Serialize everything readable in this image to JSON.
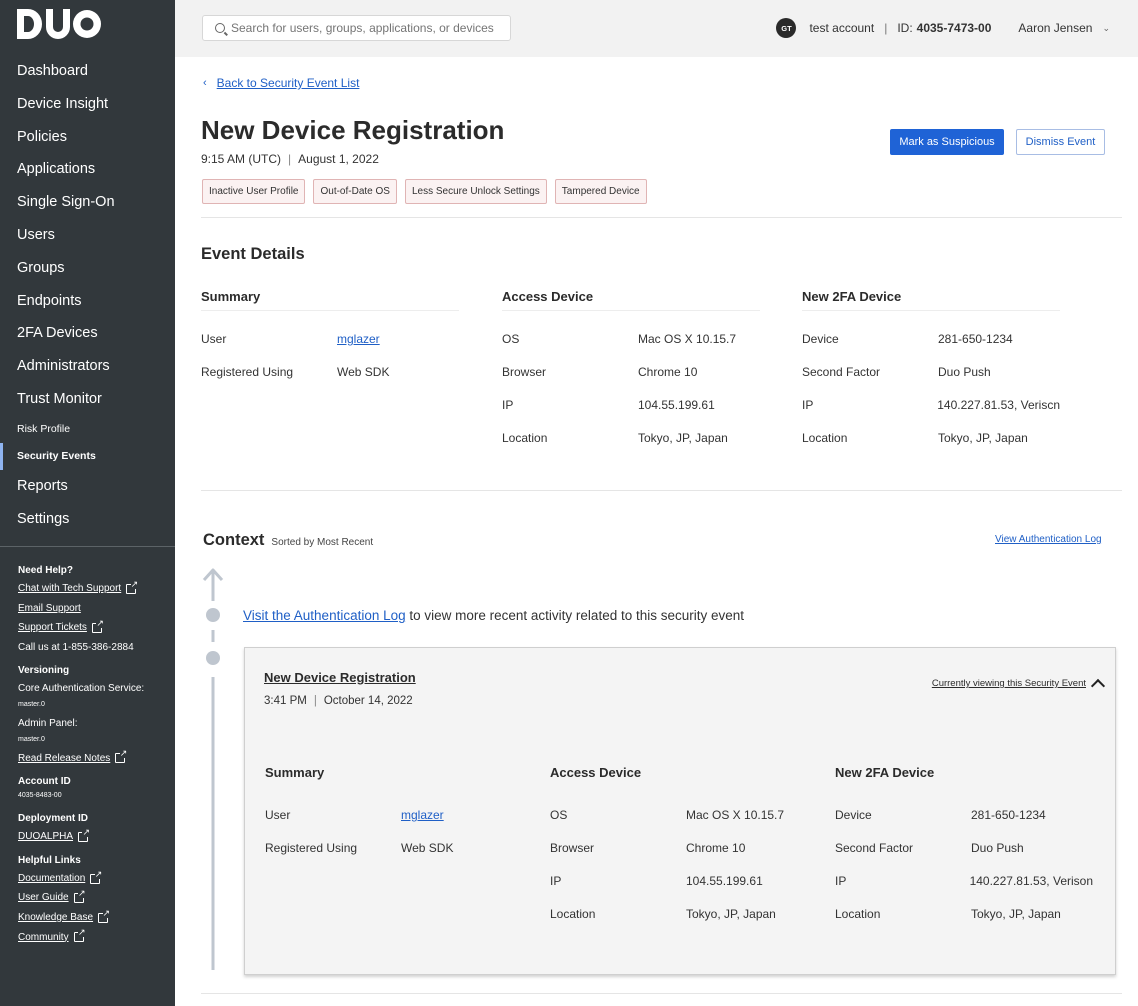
{
  "logo_text": "DUO",
  "nav": {
    "items": [
      {
        "label": "Dashboard"
      },
      {
        "label": "Device Insight"
      },
      {
        "label": "Policies"
      },
      {
        "label": "Applications"
      },
      {
        "label": "Single Sign-On"
      },
      {
        "label": "Users"
      },
      {
        "label": "Groups"
      },
      {
        "label": "Endpoints"
      },
      {
        "label": "2FA Devices"
      },
      {
        "label": "Administrators"
      },
      {
        "label": "Trust Monitor"
      }
    ],
    "sub_items": [
      {
        "label": "Risk Profile"
      },
      {
        "label": "Security Events"
      }
    ],
    "bottom_items": [
      {
        "label": "Reports"
      },
      {
        "label": "Settings"
      }
    ]
  },
  "help": {
    "need_help": "Need Help?",
    "chat": "Chat with Tech Support",
    "email": "Email Support",
    "tickets": "Support Tickets",
    "call": "Call us at 1-855-386-2884",
    "versioning": "Versioning",
    "core_label": "Core Authentication Service:",
    "core_value": "master.0",
    "admin_label": "Admin Panel:",
    "admin_value": "master.0",
    "release_notes": "Read Release Notes",
    "account_id_label": "Account ID",
    "account_id_value": "4035-8483-00",
    "deployment_label": "Deployment ID",
    "deployment_value": "DUOALPHA",
    "helpful_links": "Helpful Links",
    "documentation": "Documentation",
    "user_guide": "User Guide",
    "knowledge_base": "Knowledge Base",
    "community": "Community"
  },
  "header": {
    "search_placeholder": "Search for users, groups, applications, or devices",
    "avatar_initials": "GT",
    "account_name": "test account",
    "id_label": "ID:",
    "id_value": "4035-7473-00",
    "user_name": "Aaron Jensen"
  },
  "page": {
    "back_link": "Back to Security Event List",
    "title": "New Device Registration",
    "time": "9:15 AM (UTC)",
    "date": "August 1, 2022",
    "mark_suspicious": "Mark as Suspicious",
    "dismiss": "Dismiss Event",
    "tags": [
      "Inactive User Profile",
      "Out-of-Date OS",
      "Less Secure Unlock Settings",
      "Tampered Device"
    ]
  },
  "event_details": {
    "title": "Event Details",
    "summary": {
      "heading": "Summary",
      "user_label": "User",
      "user_value": "mglazer",
      "registered_label": "Registered Using",
      "registered_value": "Web SDK"
    },
    "access_device": {
      "heading": "Access Device",
      "os_label": "OS",
      "os_value": "Mac OS X 10.15.7",
      "browser_label": "Browser",
      "browser_value": "Chrome 10",
      "ip_label": "IP",
      "ip_value": "104.55.199.61",
      "location_label": "Location",
      "location_value": "Tokyo, JP, Japan"
    },
    "new_2fa": {
      "heading": "New 2FA Device",
      "device_label": "Device",
      "device_value": "281-650-1234",
      "factor_label": "Second Factor",
      "factor_value": "Duo Push",
      "ip_label": "IP",
      "ip_value": "140.227.81.53, Veriscn",
      "location_label": "Location",
      "location_value": "Tokyo, JP, Japan"
    }
  },
  "context": {
    "title": "Context",
    "sorted": "Sorted by Most Recent",
    "view_auth_log": "View Authentication Log",
    "visit_link": "Visit the Authentication Log",
    "visit_rest": " to view more recent activity related to this security event",
    "card": {
      "title": "New Device Registration",
      "time": "3:41 PM",
      "date": "October 14, 2022",
      "viewing": "Currently viewing this Security Event",
      "summary": {
        "heading": "Summary",
        "user_label": "User",
        "user_value": "mglazer",
        "registered_label": "Registered Using",
        "registered_value": "Web SDK"
      },
      "access_device": {
        "heading": "Access Device",
        "os_label": "OS",
        "os_value": "Mac OS X 10.15.7",
        "browser_label": "Browser",
        "browser_value": "Chrome 10",
        "ip_label": "IP",
        "ip_value": "104.55.199.61",
        "location_label": "Location",
        "location_value": "Tokyo, JP, Japan"
      },
      "new_2fa": {
        "heading": "New 2FA Device",
        "device_label": "Device",
        "device_value": "281-650-1234",
        "factor_label": "Second Factor",
        "factor_value": "Duo Push",
        "ip_label": "IP",
        "ip_value": "140.227.81.53, Verison",
        "location_label": "Location",
        "location_value": "Tokyo, JP, Japan"
      }
    }
  },
  "colors": {
    "sidebar": "#32383c",
    "primary": "#1f63d6",
    "tag_border": "#e0b4b4"
  }
}
